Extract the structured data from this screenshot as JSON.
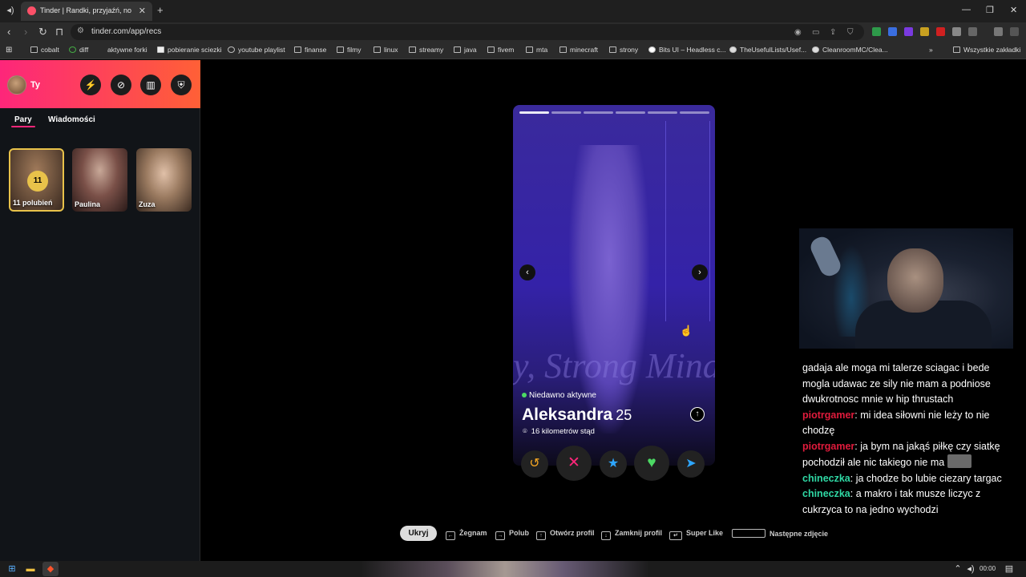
{
  "browser": {
    "tab_title": "Tinder | Randki, przyjaźń, nowe zn",
    "url": "tinder.com/app/recs",
    "new_tab": "+",
    "bookmarks": [
      "cobalt",
      "diff",
      "aktywne forki",
      "pobieranie sciezki",
      "youtube playlist",
      "finanse",
      "filmy",
      "linux",
      "streamy",
      "java",
      "fivem",
      "mta",
      "minecraft",
      "strony",
      "Bits UI – Headless c...",
      "TheUsefulLists/Usef...",
      "CleanroomMC/Clea..."
    ],
    "bookmarks_more": "»",
    "all_bookmarks": "Wszystkie zakładki"
  },
  "sidebar": {
    "user_name": "Ty",
    "tabs": [
      "Pary",
      "Wiadomości"
    ],
    "likes_count": "11",
    "likes_label": "11 polubień",
    "matches": [
      "Paulina",
      "Zuza"
    ]
  },
  "profile": {
    "status": "Niedawno aktywne",
    "name": "Aleksandra",
    "age": "25",
    "distance": "16 kilometrów stąd",
    "watermark": "y, Strong Mind",
    "photo_count": 6
  },
  "actions": {
    "rewind_icon": "↺",
    "nope_icon": "✕",
    "superlike_icon": "★",
    "like_icon": "♥",
    "boost_icon": "➤"
  },
  "shortcuts": {
    "hide": "Ukryj",
    "nope": "Żegnam",
    "like": "Polub",
    "open": "Otwórz profil",
    "close": "Zamknij profil",
    "superlike": "Super Like",
    "next_photo": "Następne zdjęcie"
  },
  "chat": {
    "messages": [
      {
        "user": "",
        "text": "gadaja ale moga mi talerze sciagac i bede mogla udawac ze sily nie mam a podniose dwukrotnosc mnie w hip thrustach"
      },
      {
        "user": "piotrgamer",
        "text": ": mi idea siłowni nie leży to nie chodzę"
      },
      {
        "user": "piotrgamer",
        "text": ": ja bym na jakąś piłkę czy siatkę pochodził ale nic takiego nie ma"
      },
      {
        "user": "chineczka",
        "text": ": ja chodze bo lubie ciezary targac"
      },
      {
        "user": "chineczka",
        "text": ": a makro i tak musze liczyc z cukrzyca to na jedno wychodzi"
      }
    ]
  },
  "taskbar": {
    "clock": "00:00"
  },
  "colors": {
    "brand_start": "#fd267a",
    "brand_end": "#ff6036",
    "chat_red": "#e01b3c",
    "chat_green": "#2fd8a4"
  }
}
